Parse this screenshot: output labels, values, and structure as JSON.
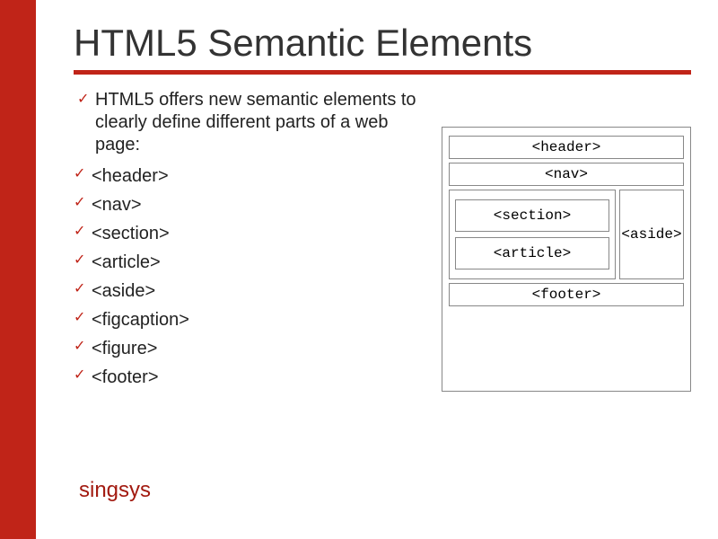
{
  "title": "HTML5 Semantic Elements",
  "intro": "HTML5 offers new semantic elements to clearly define different parts of a web page:",
  "tags": [
    "<header>",
    "<nav>",
    "<section>",
    "<article>",
    "<aside>",
    "<figcaption>",
    "<figure>",
    "<footer>"
  ],
  "diagram": {
    "header": "<header>",
    "nav": "<nav>",
    "section": "<section>",
    "article": "<article>",
    "aside": "<aside>",
    "footer": "<footer>"
  },
  "brand": "singsys"
}
